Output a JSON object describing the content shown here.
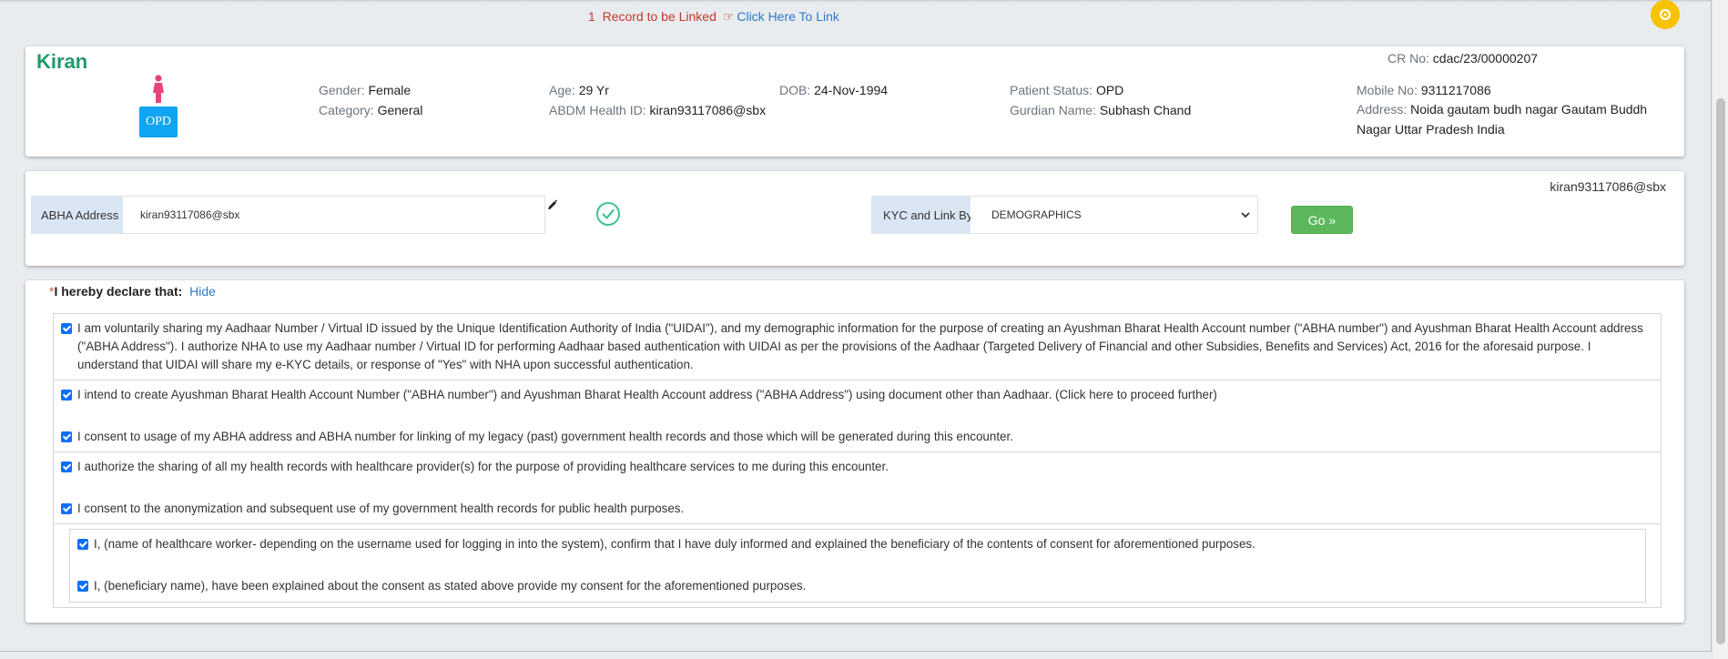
{
  "link_notice": {
    "count_text": "1",
    "message": "Record to be Linked",
    "hand_icon": "hand-pointing-icon",
    "link_text": "Click Here To Link"
  },
  "patient": {
    "name": "Kiran",
    "badge": "OPD",
    "cr_no_label": "CR No:",
    "cr_no": "cdac/23/00000207",
    "gender_label": "Gender:",
    "gender": "Female",
    "category_label": "Category:",
    "category": "General",
    "age_label": "Age:",
    "age": "29 Yr",
    "abdm_label": "ABDM Health ID:",
    "abdm_id": "kiran93117086@sbx",
    "dob_label": "DOB:",
    "dob": "24-Nov-1994",
    "status_label": "Patient Status:",
    "status": "OPD",
    "guardian_label": "Gurdian Name:",
    "guardian": "Subhash Chand",
    "mobile_label": "Mobile No:",
    "mobile": "9311217086",
    "address_label": "Address:",
    "address": "Noida gautam budh nagar Gautam Buddh Nagar Uttar Pradesh India"
  },
  "abha": {
    "address_label": "ABHA Address",
    "address_value": "kiran93117086@sbx",
    "kyc_label": "KYC and Link By",
    "kyc_selected": "DEMOGRAPHICS",
    "go_label": "Go",
    "right_value": "kiran93117086@sbx"
  },
  "consent": {
    "required_mark": "*",
    "declare_label": "I hereby declare that:",
    "hide_link": "Hide",
    "items": [
      "I am voluntarily sharing my Aadhaar Number / Virtual ID issued by the Unique Identification Authority of India (\"UIDAI\"), and my demographic information for the purpose of creating an Ayushman Bharat Health Account number (\"ABHA number\") and Ayushman Bharat Health Account address (\"ABHA Address\"). I authorize NHA to use my Aadhaar number / Virtual ID for performing Aadhaar based authentication with UIDAI as per the provisions of the Aadhaar (Targeted Delivery of Financial and other Subsidies, Benefits and Services) Act, 2016 for the aforesaid purpose. I understand that UIDAI will share my e-KYC details, or response of \"Yes\" with NHA upon successful authentication.",
      "I intend to create Ayushman Bharat Health Account Number (\"ABHA number\") and Ayushman Bharat Health Account address (\"ABHA Address\") using document other than Aadhaar. (Click here to proceed further)",
      "I consent to usage of my ABHA address and ABHA number for linking of my legacy (past) government health records and those which will be generated during this encounter.",
      "I authorize the sharing of all my health records with healthcare provider(s) for the purpose of providing healthcare services to me during this encounter.",
      "I consent to the anonymization and subsequent use of my government health records for public health purposes.",
      "I, (name of healthcare worker- depending on the username used for logging in into the system), confirm that I have duly informed and explained the beneficiary of the contents of consent for aforementioned purposes.",
      "I, (beneficiary name), have been explained about the consent as stated above provide my consent for the aforementioned purposes."
    ]
  },
  "colors": {
    "name_green": "#1e9b6b",
    "opd_blue": "#11a4f0",
    "go_green": "#5cb85c",
    "gear_yellow": "#f7c200",
    "addon_bg": "#dbe6f5"
  }
}
